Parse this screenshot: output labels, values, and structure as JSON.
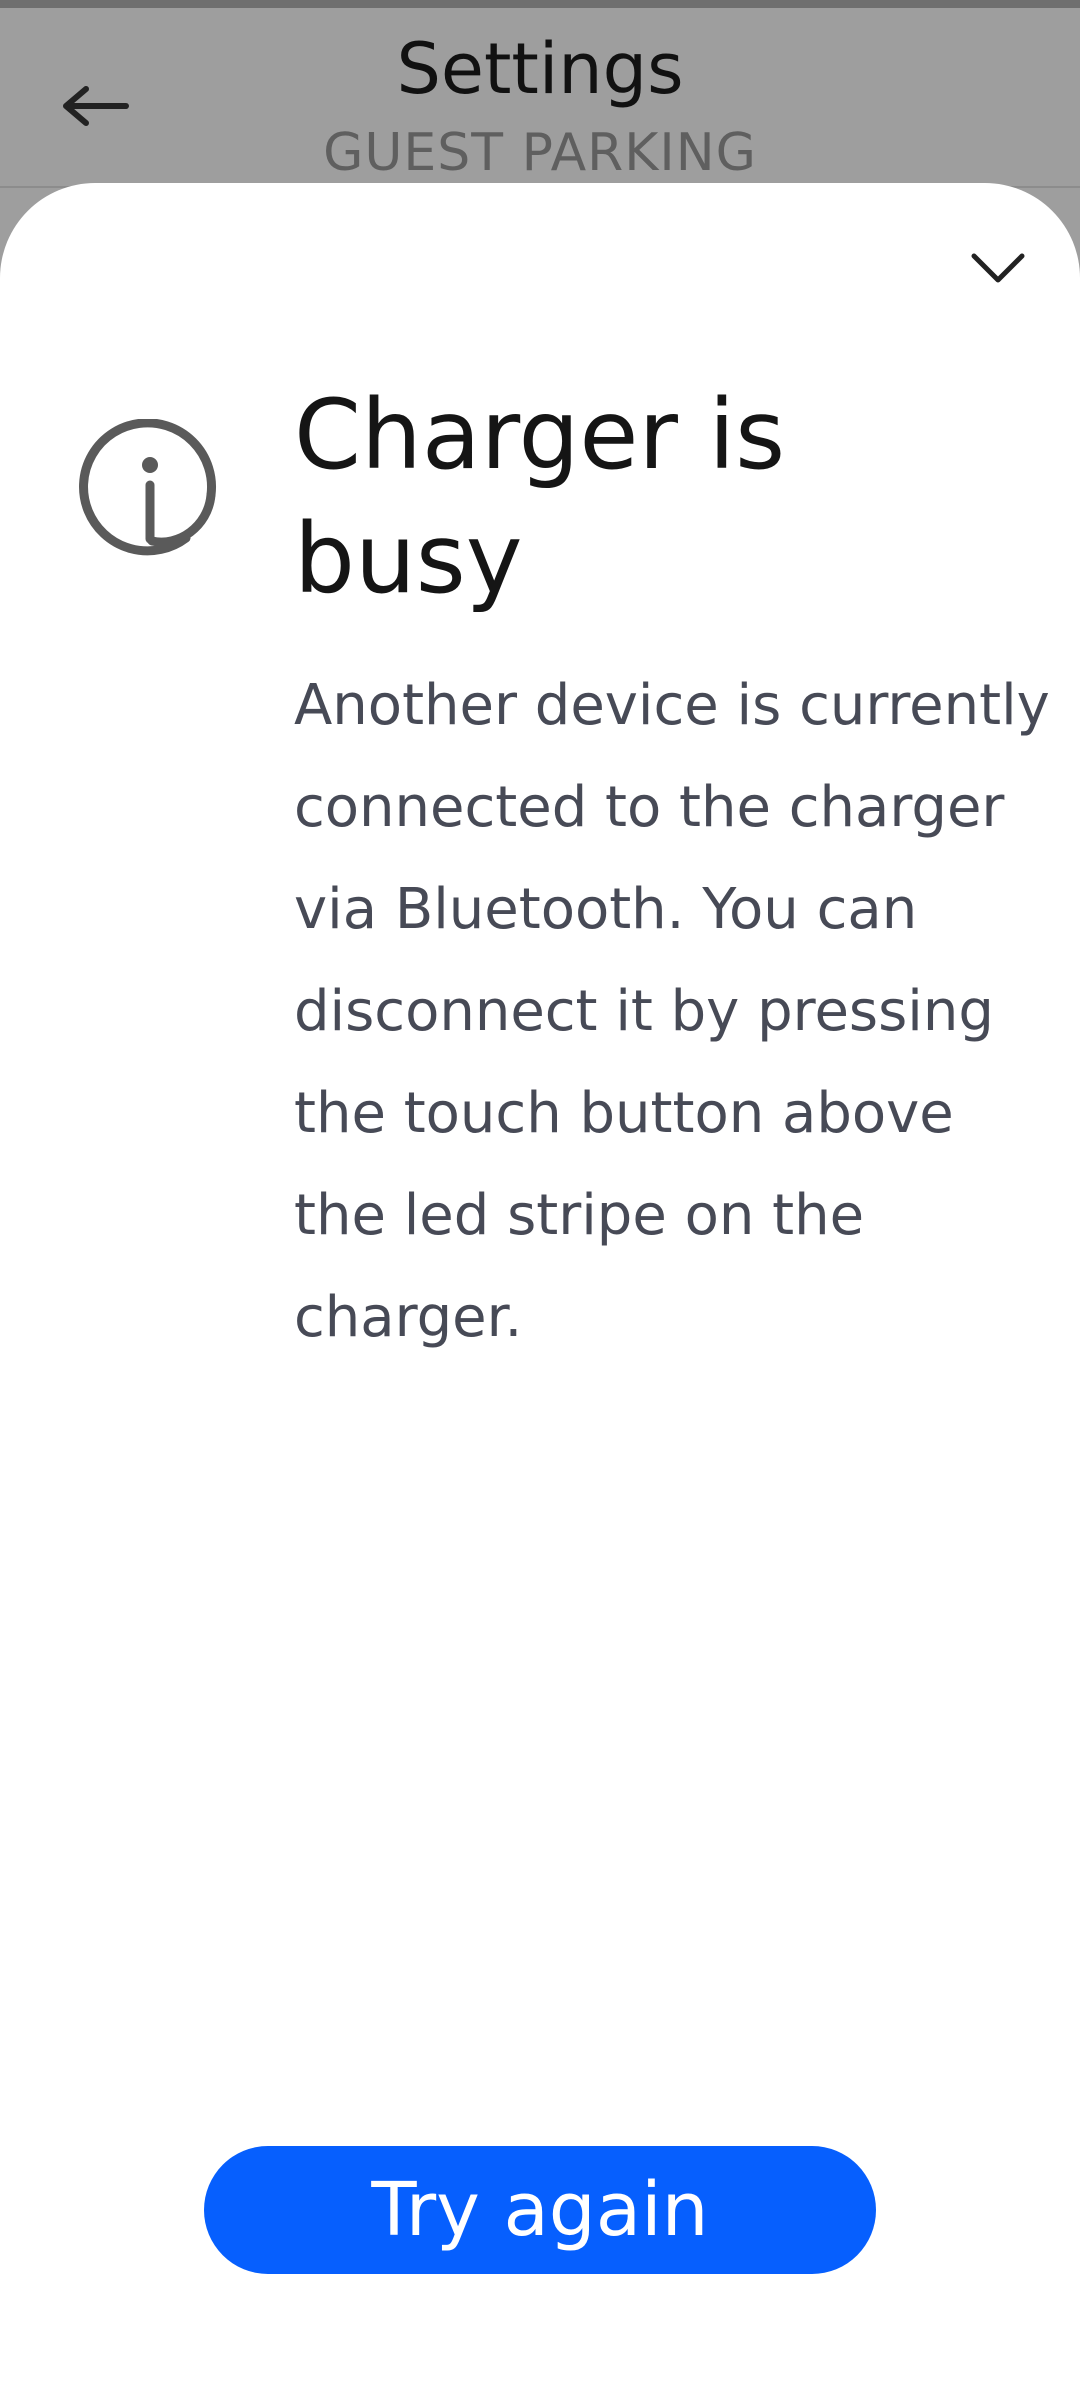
{
  "header": {
    "title": "Settings",
    "subtitle": "GUEST PARKING",
    "back_icon": "arrow-left-icon"
  },
  "sheet": {
    "collapse_icon": "chevron-down-icon",
    "status_icon": "info-icon",
    "title": "Charger is busy",
    "body": "Another device is currently connected to the charger via Bluetooth. You can disconnect it by pressing the touch button above the led stripe on the charger.",
    "primary_button_label": "Try again"
  },
  "colors": {
    "backdrop": "#9e9e9e",
    "accent": "#065ffe",
    "title_text": "#151515",
    "body_text": "#474a56",
    "icon_gray": "#5a5a5a"
  }
}
